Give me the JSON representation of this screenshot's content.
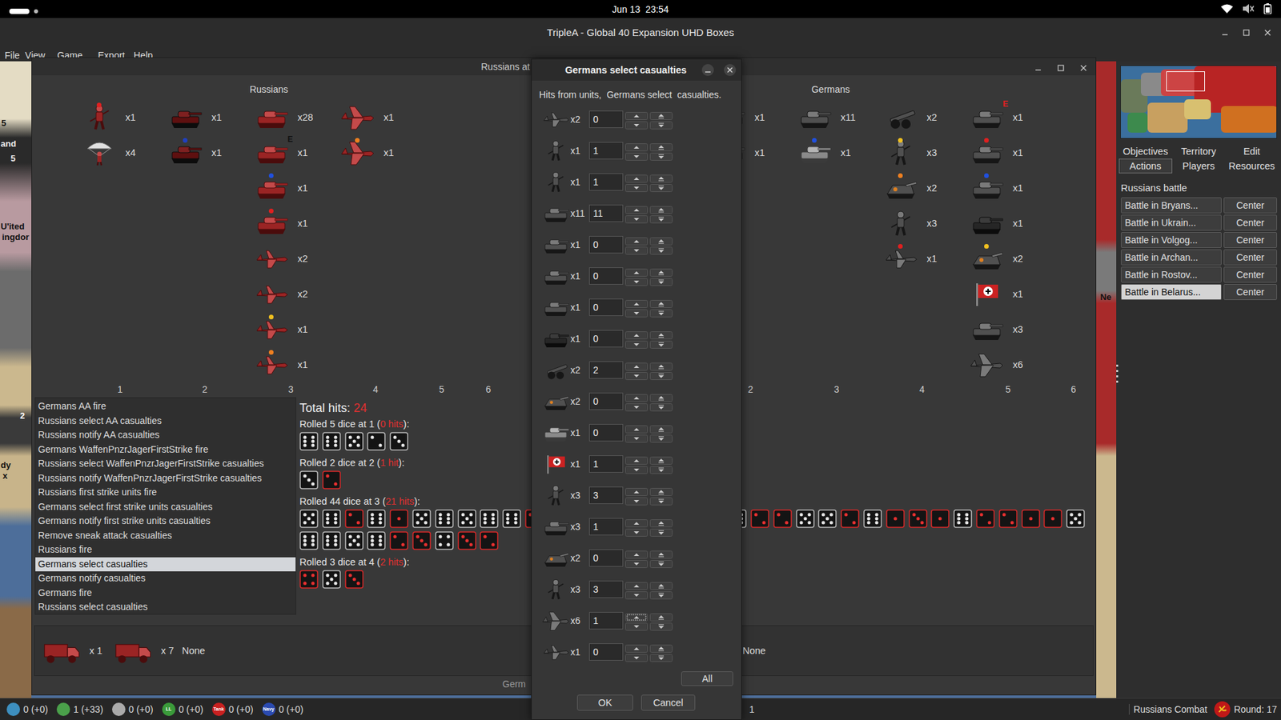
{
  "top_bar": {
    "clock": "Jun 13  23:54"
  },
  "app_window": {
    "title": "TripleA - Global 40 Expansion UHD Boxes",
    "menu": [
      "File",
      "View",
      "Game",
      "Export",
      "Help"
    ]
  },
  "map_labels": [
    {
      "text": "5"
    },
    {
      "text": "and"
    },
    {
      "text": "5"
    },
    {
      "text": "U'ited"
    },
    {
      "text": "ingdor"
    },
    {
      "text": "2"
    },
    {
      "text": "dy"
    },
    {
      "text": "x"
    },
    {
      "text": "Ne"
    }
  ],
  "battle_window": {
    "title": "Russians at",
    "russians": {
      "name": "Russians",
      "column_labels": [
        "1",
        "2",
        "3",
        "4",
        "5",
        "6"
      ],
      "columns": [
        [
          {
            "kind": "infantry",
            "count": "x1",
            "dot": "#e02020"
          },
          {
            "kind": "paratrooper",
            "count": "x4"
          }
        ],
        [
          {
            "kind": "tank-dark",
            "count": "x1"
          },
          {
            "kind": "tank-dark",
            "count": "x1",
            "dot": "#2040c0"
          }
        ],
        [
          {
            "kind": "tank",
            "count": "x28"
          },
          {
            "kind": "tank",
            "count": "x1",
            "badge": "E"
          },
          {
            "kind": "tank",
            "count": "x1",
            "dot": "#2050e0"
          },
          {
            "kind": "tank",
            "count": "x1",
            "dot": "#e02020"
          },
          {
            "kind": "fighter",
            "count": "x2"
          },
          {
            "kind": "fighter",
            "count": "x2"
          },
          {
            "kind": "fighter",
            "count": "x1",
            "dot": "#f0c020"
          },
          {
            "kind": "fighter",
            "count": "x1",
            "dot": "#f08020"
          }
        ],
        [
          {
            "kind": "bomber",
            "count": "x1"
          },
          {
            "kind": "bomber",
            "count": "x1",
            "dot": "#f08020"
          }
        ]
      ]
    },
    "germans": {
      "name": "Germans",
      "column_labels": [
        "2",
        "3",
        "4",
        "5",
        "6"
      ],
      "columns": [
        [
          {
            "kind": "tank",
            "count": "x1"
          },
          {
            "kind": "tank",
            "count": "x1"
          }
        ],
        [
          {
            "kind": "tank",
            "count": "x11"
          },
          {
            "kind": "heavy-tank",
            "count": "x1",
            "dot": "#2050e0"
          }
        ],
        [
          {
            "kind": "artillery",
            "count": "x2"
          },
          {
            "kind": "elite-infantry",
            "count": "x3",
            "dot": "#f0c020"
          },
          {
            "kind": "spg",
            "count": "x2",
            "dot": "#f08020"
          },
          {
            "kind": "infantry",
            "count": "x3"
          },
          {
            "kind": "fighter",
            "count": "x1",
            "dot": "#e02020"
          }
        ],
        [
          {
            "kind": "tank",
            "count": "x1",
            "badge": "E"
          },
          {
            "kind": "tank",
            "count": "x1",
            "dot": "#e02020"
          },
          {
            "kind": "tank",
            "count": "x1",
            "dot": "#2050e0"
          },
          {
            "kind": "tank-dark",
            "count": "x1"
          },
          {
            "kind": "spg",
            "count": "x2",
            "dot": "#f0c020"
          },
          {
            "kind": "flag",
            "count": "x1"
          },
          {
            "kind": "tank",
            "count": "x3"
          },
          {
            "kind": "bomber",
            "count": "x6"
          }
        ]
      ]
    },
    "steps": [
      {
        "label": "Germans AA fire",
        "selected": false
      },
      {
        "label": "Russians select AA casualties",
        "selected": false
      },
      {
        "label": "Russians notify AA casualties",
        "selected": false
      },
      {
        "label": "Germans WaffenPnzrJagerFirstStrike fire",
        "selected": false
      },
      {
        "label": "Russians select WaffenPnzrJagerFirstStrike casualties",
        "selected": false
      },
      {
        "label": "Russians notify WaffenPnzrJagerFirstStrike casualties",
        "selected": false
      },
      {
        "label": "Russians first strike units fire",
        "selected": false
      },
      {
        "label": "Germans select first strike units casualties",
        "selected": false
      },
      {
        "label": "Germans notify first strike units casualties",
        "selected": false
      },
      {
        "label": "Remove sneak attack casualties",
        "selected": false
      },
      {
        "label": "Russians fire",
        "selected": false
      },
      {
        "label": "Germans select casualties",
        "selected": true
      },
      {
        "label": "Germans notify casualties",
        "selected": false
      },
      {
        "label": "Germans fire",
        "selected": false
      },
      {
        "label": "Russians select casualties",
        "selected": false
      }
    ],
    "dice": {
      "total_label": "Total hits: ",
      "total": "24",
      "rolls": [
        {
          "prefix": "Rolled 5 dice at 1 (",
          "hits": "0 hits",
          "suffix": "):",
          "lines": [
            [
              {
                "value": 6,
                "hit": false
              },
              {
                "value": 6,
                "hit": false
              },
              {
                "value": 5,
                "hit": false
              },
              {
                "value": 2,
                "hit": false
              },
              {
                "value": 3,
                "hit": false
              }
            ]
          ]
        },
        {
          "prefix": "Rolled 2 dice at 2 (",
          "hits": "1 hit",
          "suffix": "):",
          "lines": [
            [
              {
                "value": 3,
                "hit": false
              },
              {
                "value": 2,
                "hit": true
              }
            ]
          ]
        },
        {
          "prefix": "Rolled 44 dice at 3 (",
          "hits": "21 hits",
          "suffix": "):",
          "lines": [
            [
              {
                "value": 5,
                "hit": false
              },
              {
                "value": 6,
                "hit": false
              },
              {
                "value": 2,
                "hit": true
              },
              {
                "value": 6,
                "hit": false
              },
              {
                "value": 1,
                "hit": true
              },
              {
                "value": 5,
                "hit": false
              },
              {
                "value": 6,
                "hit": false
              },
              {
                "value": 5,
                "hit": false
              },
              {
                "value": 6,
                "hit": false
              },
              {
                "value": 6,
                "hit": false
              },
              {
                "value": 3,
                "hit": true
              },
              {
                "value": 5,
                "hit": false
              },
              {
                "value": 2,
                "hit": true
              },
              {
                "value": 4,
                "hit": false
              },
              {
                "value": 1,
                "hit": true
              },
              {
                "value": 6,
                "hit": false
              },
              {
                "value": 3,
                "hit": true
              },
              {
                "value": 5,
                "hit": false
              },
              {
                "value": 2,
                "hit": true
              },
              {
                "value": 6,
                "hit": false
              },
              {
                "value": 2,
                "hit": true
              },
              {
                "value": 2,
                "hit": true
              },
              {
                "value": 5,
                "hit": false
              },
              {
                "value": 5,
                "hit": false
              },
              {
                "value": 2,
                "hit": true
              },
              {
                "value": 6,
                "hit": false
              },
              {
                "value": 1,
                "hit": true
              },
              {
                "value": 3,
                "hit": true
              },
              {
                "value": 1,
                "hit": true
              },
              {
                "value": 6,
                "hit": false
              },
              {
                "value": 2,
                "hit": true
              },
              {
                "value": 2,
                "hit": true
              },
              {
                "value": 1,
                "hit": true
              },
              {
                "value": 1,
                "hit": true
              },
              {
                "value": 5,
                "hit": false
              }
            ],
            [
              {
                "value": 6,
                "hit": false
              },
              {
                "value": 6,
                "hit": false
              },
              {
                "value": 5,
                "hit": false
              },
              {
                "value": 6,
                "hit": false
              },
              {
                "value": 2,
                "hit": true
              },
              {
                "value": 3,
                "hit": true
              },
              {
                "value": 4,
                "hit": false
              },
              {
                "value": 3,
                "hit": true
              },
              {
                "value": 2,
                "hit": true
              }
            ]
          ]
        },
        {
          "prefix": "Rolled 3 dice at 4 (",
          "hits": "2 hits",
          "suffix": "):",
          "lines": [
            [
              {
                "value": 4,
                "hit": true
              },
              {
                "value": 5,
                "hit": false
              },
              {
                "value": 3,
                "hit": true
              }
            ]
          ]
        }
      ]
    },
    "casualties": {
      "russian": [
        {
          "kind": "truck",
          "count": "x 1"
        },
        {
          "kind": "truck",
          "count": "x 7"
        }
      ],
      "russian_note": "None",
      "german_note": "None"
    },
    "status": "Germ"
  },
  "dialog": {
    "title": "Germans select casualties",
    "subtitle": "Hits from units,  Germans select  casualties.",
    "rows": [
      {
        "kind": "fighter",
        "count": "x2",
        "value": "0",
        "focused": false
      },
      {
        "kind": "infantry",
        "count": "x1",
        "value": "1",
        "focused": false
      },
      {
        "kind": "infantry",
        "count": "x1",
        "value": "1",
        "focused": false
      },
      {
        "kind": "tank",
        "count": "x11",
        "value": "11",
        "focused": false
      },
      {
        "kind": "tank",
        "count": "x1",
        "value": "0",
        "focused": false
      },
      {
        "kind": "tank",
        "count": "x1",
        "value": "0",
        "focused": false
      },
      {
        "kind": "tank",
        "count": "x1",
        "value": "0",
        "focused": false
      },
      {
        "kind": "tank-dark",
        "count": "x1",
        "value": "0",
        "focused": false
      },
      {
        "kind": "artillery",
        "count": "x2",
        "value": "2",
        "focused": false
      },
      {
        "kind": "spg",
        "count": "x2",
        "value": "0",
        "focused": false
      },
      {
        "kind": "heavy-tank",
        "count": "x1",
        "value": "0",
        "focused": false
      },
      {
        "kind": "flag",
        "count": "x1",
        "value": "1",
        "focused": false
      },
      {
        "kind": "elite-infantry",
        "count": "x3",
        "value": "3",
        "focused": false
      },
      {
        "kind": "tank",
        "count": "x3",
        "value": "1",
        "focused": false
      },
      {
        "kind": "spg",
        "count": "x2",
        "value": "0",
        "focused": false
      },
      {
        "kind": "infantry",
        "count": "x3",
        "value": "3",
        "focused": false
      },
      {
        "kind": "bomber",
        "count": "x6",
        "value": "1",
        "focused": true
      },
      {
        "kind": "fighter",
        "count": "x1",
        "value": "0",
        "focused": false
      }
    ],
    "all_button": "All",
    "buttons": [
      "OK",
      "Cancel"
    ]
  },
  "side_panel": {
    "tabs": [
      {
        "label": "Objectives",
        "selected": false
      },
      {
        "label": "Territory",
        "selected": false
      },
      {
        "label": "Edit",
        "selected": false
      },
      {
        "label": "Actions",
        "selected": true
      },
      {
        "label": "Players",
        "selected": false
      },
      {
        "label": "Resources",
        "selected": false
      }
    ],
    "heading": "Russians battle",
    "battles": [
      {
        "label": "Battle in Bryans...",
        "center": "Center",
        "selected": false
      },
      {
        "label": "Battle in Ukrain...",
        "center": "Center",
        "selected": false
      },
      {
        "label": "Battle in Volgog...",
        "center": "Center",
        "selected": false
      },
      {
        "label": "Battle in Archan...",
        "center": "Center",
        "selected": false
      },
      {
        "label": "Battle in Rostov...",
        "center": "Center",
        "selected": false
      },
      {
        "label": "Battle in Belarus...",
        "center": "Center",
        "selected": true
      }
    ]
  },
  "status_bar": {
    "resources": [
      {
        "icon_label": "",
        "value": "0 (+0)"
      },
      {
        "icon_label": "",
        "value": "1 (+33)"
      },
      {
        "icon_label": "",
        "value": "0 (+0)"
      },
      {
        "icon_label": "LL",
        "value": "0 (+0)"
      },
      {
        "icon_label": "Tank",
        "value": "0 (+0)"
      },
      {
        "icon_label": "Navy",
        "value": "0 (+0)"
      }
    ],
    "player_count": "1",
    "phase": "Russians Combat",
    "round": "Round: 17"
  }
}
